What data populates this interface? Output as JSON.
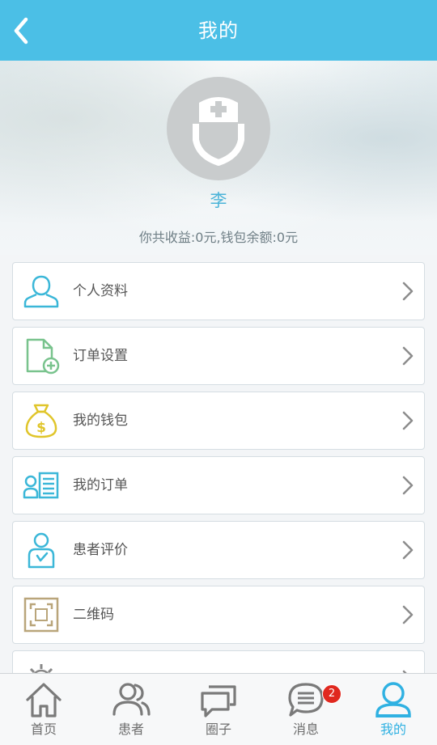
{
  "header": {
    "title": "我的",
    "back_icon": "chevron-left-icon"
  },
  "profile": {
    "name": "李",
    "summary": "你共收益:0元,钱包余额:0元",
    "avatar_icon": "doctor-avatar-icon"
  },
  "menu": [
    {
      "label": "个人资料",
      "icon": "person-icon",
      "color": "#3bb7d8"
    },
    {
      "label": "订单设置",
      "icon": "document-add-icon",
      "color": "#79c38d"
    },
    {
      "label": "我的钱包",
      "icon": "money-bag-icon",
      "color": "#e0c52a"
    },
    {
      "label": "我的订单",
      "icon": "order-list-icon",
      "color": "#3bb7d8"
    },
    {
      "label": "患者评价",
      "icon": "patient-review-icon",
      "color": "#3bb7d8"
    },
    {
      "label": "二维码",
      "icon": "qr-frame-icon",
      "color": "#b9a57a"
    },
    {
      "label": "",
      "icon": "gear-icon",
      "color": "#888888"
    }
  ],
  "tabs": [
    {
      "label": "首页",
      "icon": "home-icon"
    },
    {
      "label": "患者",
      "icon": "patients-icon"
    },
    {
      "label": "圈子",
      "icon": "chat-bubbles-icon"
    },
    {
      "label": "消息",
      "icon": "message-icon",
      "badge": "2"
    },
    {
      "label": "我的",
      "icon": "profile-icon",
      "active": true
    }
  ],
  "colors": {
    "header_bg": "#4bbfe6",
    "active_tab": "#2fb1e2",
    "badge": "#e0281f",
    "name_text": "#4ab3d8"
  }
}
